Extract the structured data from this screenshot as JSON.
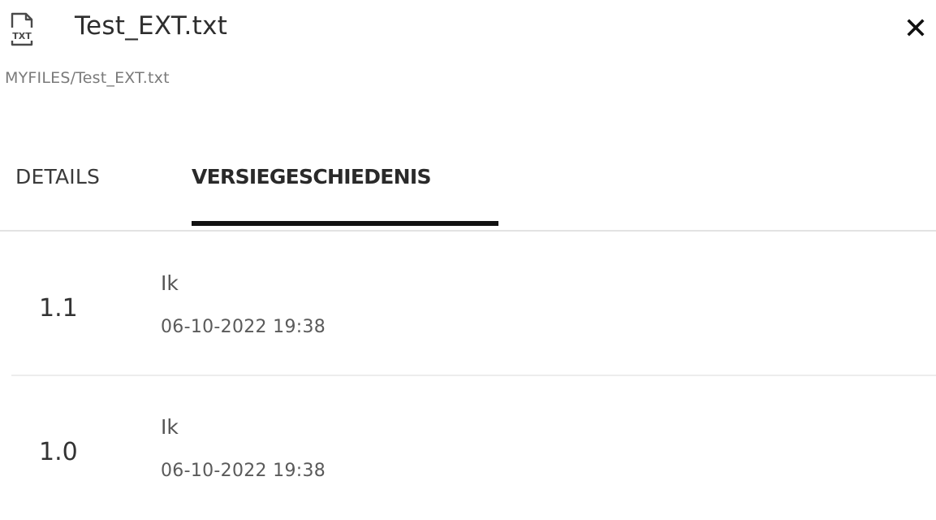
{
  "header": {
    "file_icon": "txt-file-icon",
    "file_icon_label": "TXT",
    "title": "Test_EXT.txt",
    "close_icon": "close-icon",
    "breadcrumb": "MYFILES/Test_EXT.txt"
  },
  "tabs": [
    {
      "label": "DETAILS",
      "active": false
    },
    {
      "label": "VERSIEGESCHIEDENIS",
      "active": true
    }
  ],
  "versions": [
    {
      "number": "1.1",
      "author": "Ik",
      "date": "06-10-2022 19:38"
    },
    {
      "number": "1.0",
      "author": "Ik",
      "date": "06-10-2022 19:38"
    }
  ],
  "colors": {
    "text_primary": "#2e2e2e",
    "text_muted": "#7a7a7a",
    "active_tab_indicator": "#111111",
    "divider": "#e3e3e3"
  }
}
